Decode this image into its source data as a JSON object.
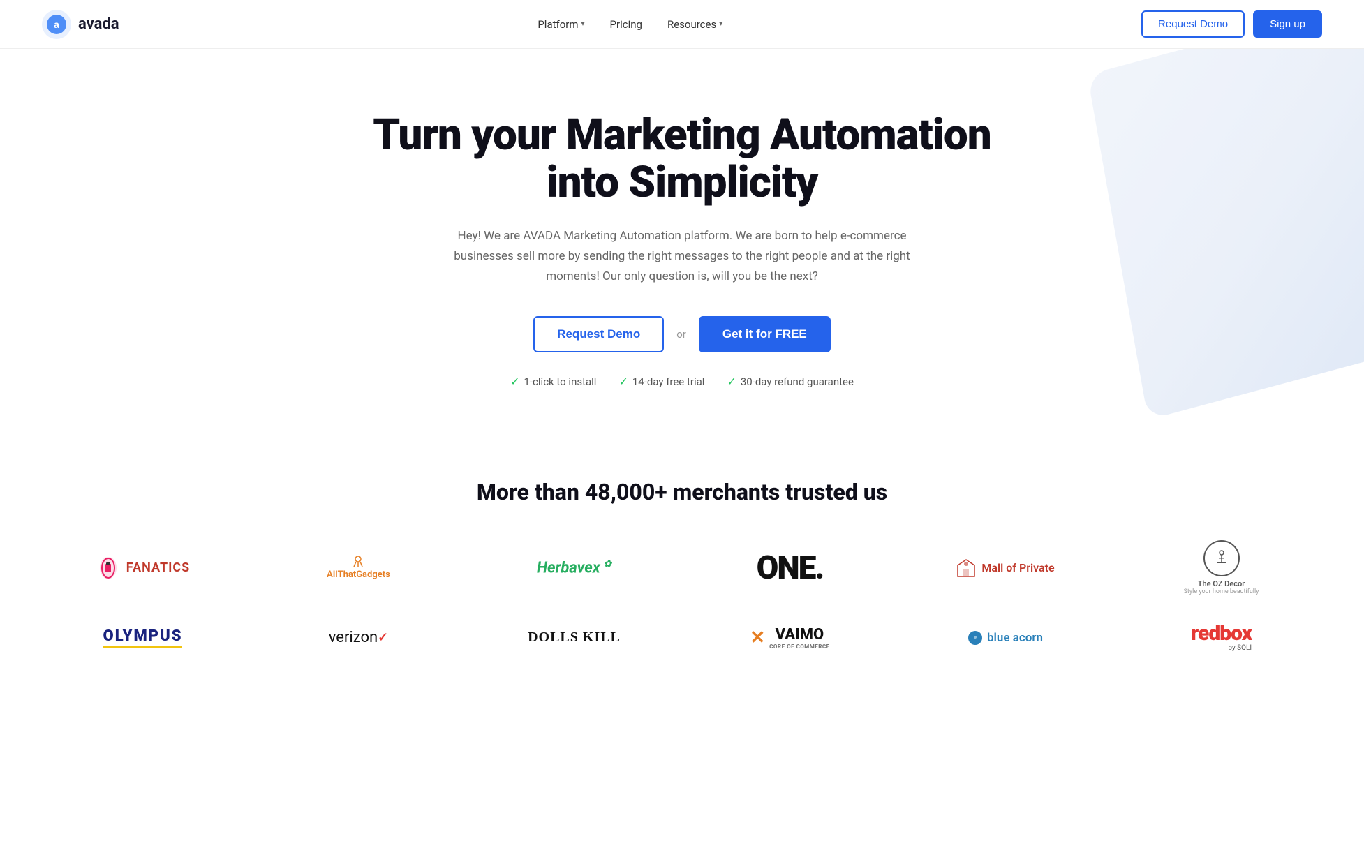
{
  "nav": {
    "logo_text": "avada",
    "links": [
      {
        "label": "Platform",
        "has_dropdown": true
      },
      {
        "label": "Pricing",
        "has_dropdown": false
      },
      {
        "label": "Resources",
        "has_dropdown": true
      }
    ],
    "request_demo": "Request Demo",
    "sign_up": "Sign up"
  },
  "hero": {
    "title": "Turn your Marketing Automation into Simplicity",
    "subtitle": "Hey! We are AVADA Marketing Automation platform. We are born to help e-commerce businesses sell more by sending the right messages to the right people and at the right moments! Our only question is, will you be the next?",
    "cta_demo": "Request Demo",
    "cta_or": "or",
    "cta_free": "Get it for FREE",
    "badges": [
      "1-click to install",
      "14-day free trial",
      "30-day refund guarantee"
    ]
  },
  "trusted": {
    "title": "More than 48,000+ merchants trusted us",
    "logos_row1": [
      {
        "name": "Fanatics",
        "type": "fanatics"
      },
      {
        "name": "AllThatGadgets",
        "type": "allthat"
      },
      {
        "name": "Herbavex",
        "type": "herbavex"
      },
      {
        "name": "ONE.",
        "type": "one"
      },
      {
        "name": "Mall of Private",
        "type": "mallofprivate"
      },
      {
        "name": "The OZ Decor",
        "type": "ozdecor"
      }
    ],
    "logos_row2": [
      {
        "name": "OLYMPUS",
        "type": "olympus"
      },
      {
        "name": "verizon",
        "type": "verizon"
      },
      {
        "name": "DOLLS KILL",
        "type": "dollskill"
      },
      {
        "name": "VAIMO",
        "type": "vaimo"
      },
      {
        "name": "blue acorn",
        "type": "blueacorn"
      },
      {
        "name": "redbox",
        "type": "redbox"
      }
    ]
  }
}
